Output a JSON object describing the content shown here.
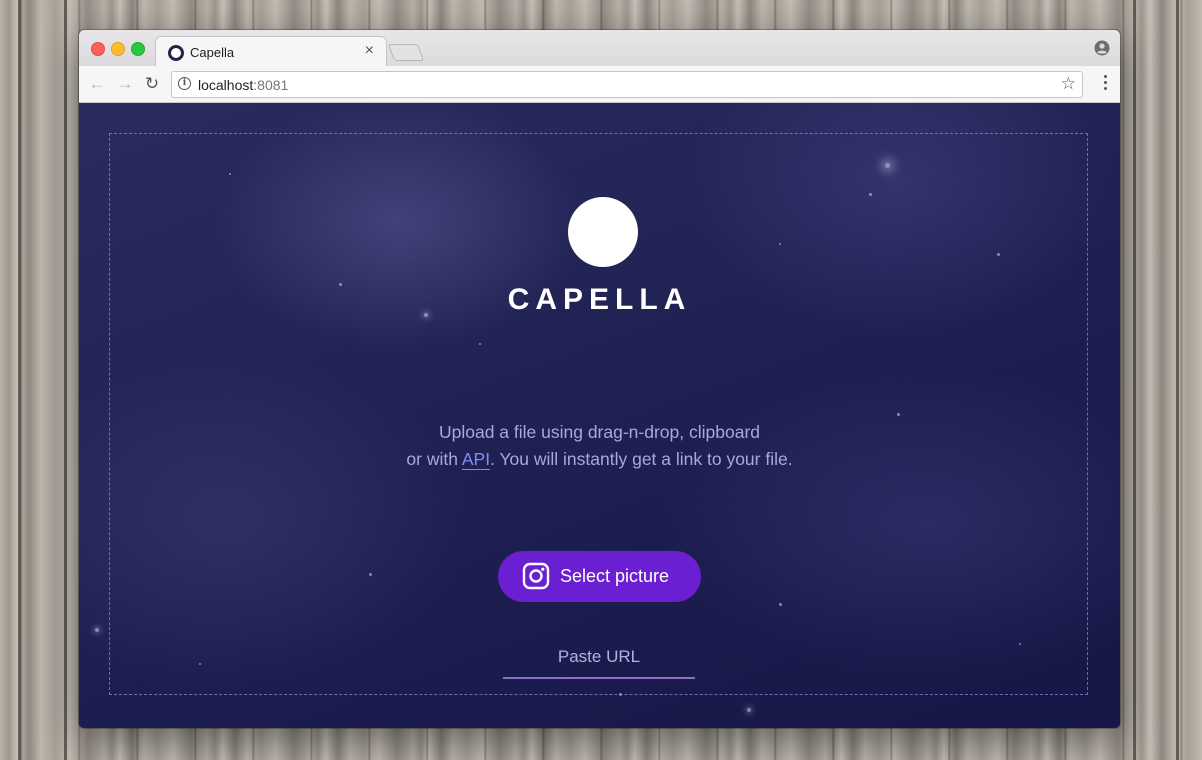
{
  "browser": {
    "tab_title": "Capella",
    "tab_close": "×",
    "url_host": "localhost",
    "url_port": ":8081"
  },
  "page": {
    "brand": "CAPELLA",
    "desc_line1": "Upload a file using drag-n-drop, clipboard",
    "desc_prefix": "or with ",
    "desc_link": "API",
    "desc_suffix": ". You will instantly get a link to your file.",
    "select_button": "Select picture",
    "paste_url_placeholder": "Paste URL"
  },
  "colors": {
    "background": "#1c1d4f",
    "accent_button": "#6b1fd3",
    "link": "#7f8cf0",
    "dashed_border": "#968cdc"
  },
  "icons": [
    "info-icon",
    "star-icon",
    "menu-icon",
    "profile-icon",
    "back-arrow-icon",
    "forward-arrow-icon",
    "reload-icon",
    "instagram-camera-icon"
  ]
}
